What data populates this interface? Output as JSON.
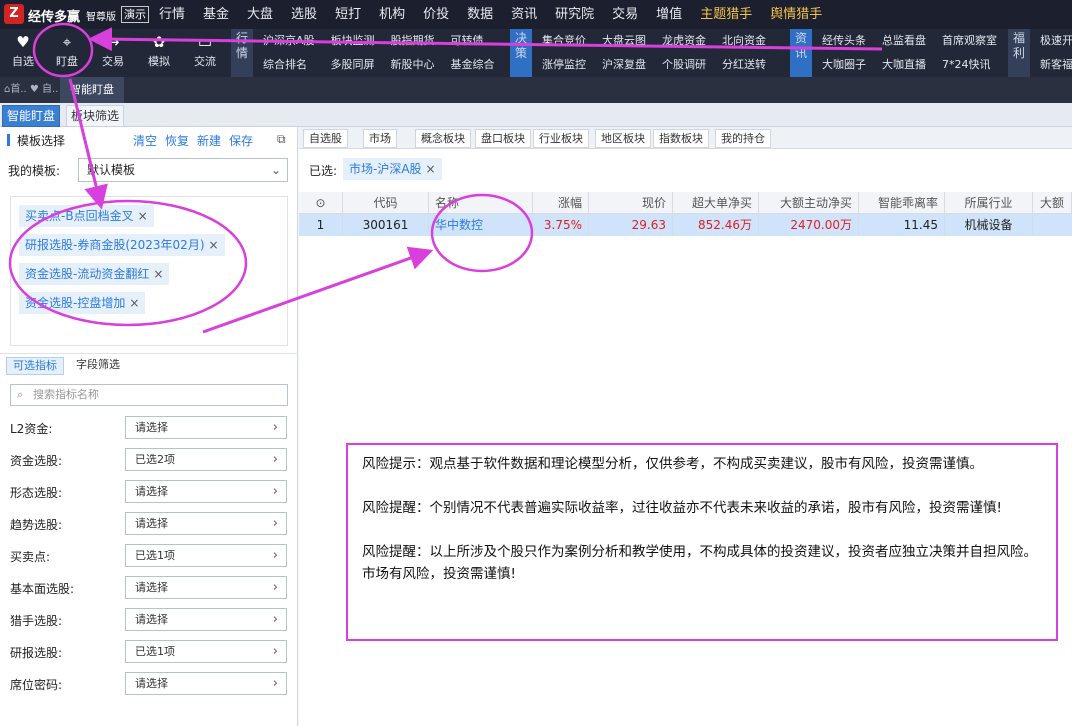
{
  "app": {
    "logo_char": "Z",
    "name": "经传多赢",
    "edition": "智尊版",
    "demo_badge": "演示",
    "top_menu": [
      "行情",
      "基金",
      "大盘",
      "选股",
      "短打",
      "机构",
      "价投",
      "数据",
      "资讯",
      "研究院",
      "交易",
      "增值",
      "主题猎手",
      "舆情猎手"
    ]
  },
  "toolbar": {
    "buttons": [
      {
        "label": "自选",
        "icon": "heart-icon",
        "glyph": "♥"
      },
      {
        "label": "盯盘",
        "icon": "chart-icon",
        "glyph": "⌖"
      },
      {
        "label": "交易",
        "icon": "trade-icon",
        "glyph": "↔"
      },
      {
        "label": "模拟",
        "icon": "bow-icon",
        "glyph": "✿"
      },
      {
        "label": "交流",
        "icon": "chat-icon",
        "glyph": "▭"
      }
    ],
    "sections": [
      {
        "label": "行情",
        "blue": false,
        "items": [
          "沪深京A股",
          "综合排名",
          "板块监测",
          "多股同屏",
          "股指期货",
          "新股中心",
          "可转债",
          "基金综合"
        ]
      },
      {
        "label": "决策",
        "blue": true,
        "items": [
          "集合竞价",
          "涨停监控",
          "大盘云图",
          "沪深复盘",
          "龙虎资金",
          "个股调研",
          "北向资金",
          "分红送转"
        ]
      },
      {
        "label": "资讯",
        "blue": true,
        "items": [
          "经传头条",
          "大咖圈子",
          "总监看盘",
          "大咖直播",
          "首席观察室",
          "7*24快讯"
        ]
      },
      {
        "label": "福利",
        "blue": false,
        "items": [
          "极速开户",
          "新客福利"
        ]
      }
    ]
  },
  "quickbar": {
    "home": "⌂首.. ♥ 自..",
    "tab": "智能盯盘"
  },
  "subtabs": [
    "智能盯盘",
    "板块筛选"
  ],
  "left": {
    "template_title": "模板选择",
    "actions": [
      "清空",
      "恢复",
      "新建",
      "保存"
    ],
    "copy_glyph": "⧉",
    "my_template_label": "我的模板:",
    "my_template_value": "默认模板",
    "tags": [
      "买卖点-B点回档金叉",
      "研报选股-券商金股(2023年02月)",
      "资金选股-流动资金翻红",
      "资金选股-控盘增加"
    ],
    "filter_tabs": [
      "可选指标",
      "字段筛选"
    ],
    "search_placeholder": "搜索指标名称",
    "filters": [
      {
        "label": "L2资金:",
        "value": "请选择"
      },
      {
        "label": "资金选股:",
        "value": "已选2项"
      },
      {
        "label": "形态选股:",
        "value": "请选择"
      },
      {
        "label": "趋势选股:",
        "value": "请选择"
      },
      {
        "label": "买卖点:",
        "value": "已选1项"
      },
      {
        "label": "基本面选股:",
        "value": "请选择"
      },
      {
        "label": "猎手选股:",
        "value": "请选择"
      },
      {
        "label": "研报选股:",
        "value": "已选1项"
      },
      {
        "label": "席位密码:",
        "value": "请选择"
      }
    ]
  },
  "right": {
    "category_tabs": [
      "自选股",
      "市场",
      "概念板块",
      "盘口板块",
      "行业板块",
      "地区板块",
      "指数板块",
      "我的持仓"
    ],
    "selected_label": "已选:",
    "selected_chip": "市场-沪深A股",
    "columns": [
      "⊙",
      "代码",
      "名称",
      "涨幅",
      "现价",
      "超大单净买",
      "大额主动净买",
      "智能乖离率",
      "所属行业",
      "大额"
    ],
    "rows": [
      {
        "idx": "1",
        "code": "300161",
        "name": "华中数控",
        "change": "3.75%",
        "price": "29.63",
        "super_net": "852.46万",
        "big_net": "2470.00万",
        "deviation": "11.45",
        "industry": "机械设备"
      }
    ]
  },
  "risk": [
    "风险提示：观点基于软件数据和理论模型分析，仅供参考，不构成买卖建议，股市有风险，投资需谨慎。",
    "风险提醒：个别情况不代表普遍实际收益率，过往收益亦不代表未来收益的承诺，股市有风险，投资需谨慎!",
    "风险提醒：以上所涉及个股只作为案例分析和教学使用，不构成具体的投资建议，投资者应独立决策并自担风险。市场有风险，投资需谨慎!"
  ],
  "colors": {
    "annotation": "#d93fdc",
    "up": "#e02020",
    "link": "#2d7be0",
    "row_highlight": "#cfe3fb"
  }
}
